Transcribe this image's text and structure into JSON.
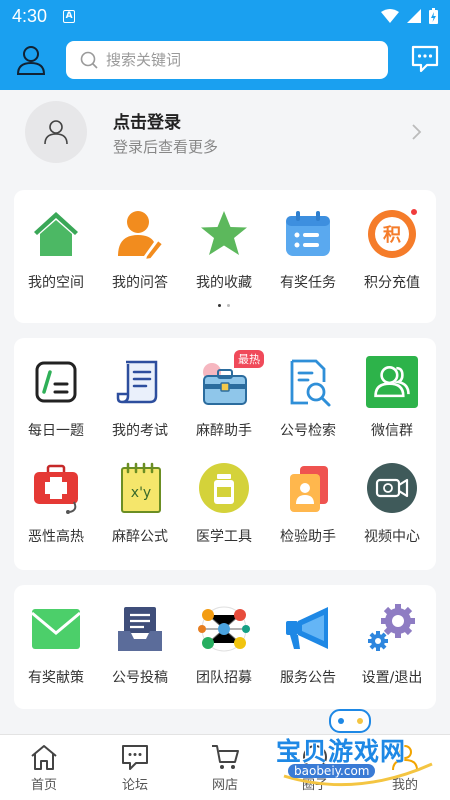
{
  "status_bar": {
    "time": "4:30",
    "notification_letter": "A"
  },
  "search": {
    "placeholder": "搜索关键词"
  },
  "login": {
    "title": "点击登录",
    "subtitle": "登录后查看更多"
  },
  "section1": {
    "items": [
      {
        "label": "我的空间",
        "icon": "home-icon"
      },
      {
        "label": "我的问答",
        "icon": "user-edit-icon"
      },
      {
        "label": "我的收藏",
        "icon": "star-icon"
      },
      {
        "label": "有奖任务",
        "icon": "calendar-task-icon"
      },
      {
        "label": "积分充值",
        "icon": "points-icon",
        "icon_text": "积"
      }
    ],
    "page_count": 2,
    "active_page": 1
  },
  "section2": {
    "items": [
      {
        "label": "每日一题",
        "icon": "daily-question-icon"
      },
      {
        "label": "我的考试",
        "icon": "exam-scroll-icon"
      },
      {
        "label": "麻醉助手",
        "icon": "toolbox-icon",
        "badge": "最热"
      },
      {
        "label": "公号检索",
        "icon": "document-search-icon"
      },
      {
        "label": "微信群",
        "icon": "wechat-group-icon"
      },
      {
        "label": "恶性高热",
        "icon": "medical-kit-icon"
      },
      {
        "label": "麻醉公式",
        "icon": "formula-notebook-icon",
        "icon_text": "x'y"
      },
      {
        "label": "医学工具",
        "icon": "medicine-bottle-icon"
      },
      {
        "label": "检验助手",
        "icon": "lab-report-icon"
      },
      {
        "label": "视频中心",
        "icon": "video-camera-icon"
      }
    ]
  },
  "section3": {
    "items": [
      {
        "label": "有奖献策",
        "icon": "mail-icon"
      },
      {
        "label": "公号投稿",
        "icon": "inbox-tray-icon"
      },
      {
        "label": "团队招募",
        "icon": "team-network-icon"
      },
      {
        "label": "服务公告",
        "icon": "megaphone-icon"
      },
      {
        "label": "设置/退出",
        "icon": "settings-gears-icon"
      }
    ]
  },
  "bottom_nav": {
    "items": [
      {
        "label": "首页",
        "icon": "home-outline-icon"
      },
      {
        "label": "论坛",
        "icon": "chat-bubble-icon"
      },
      {
        "label": "网店",
        "icon": "cart-icon"
      },
      {
        "label": "圈子",
        "icon": "circle-icon"
      },
      {
        "label": "我的",
        "icon": "mine-icon"
      }
    ],
    "active": "我的"
  },
  "watermark": {
    "title": "宝贝游戏网",
    "url": "baobeiy.com"
  },
  "colors": {
    "primary": "#1aa0f0",
    "badge_red": "#f04a5a",
    "background": "#f4f5f7"
  }
}
